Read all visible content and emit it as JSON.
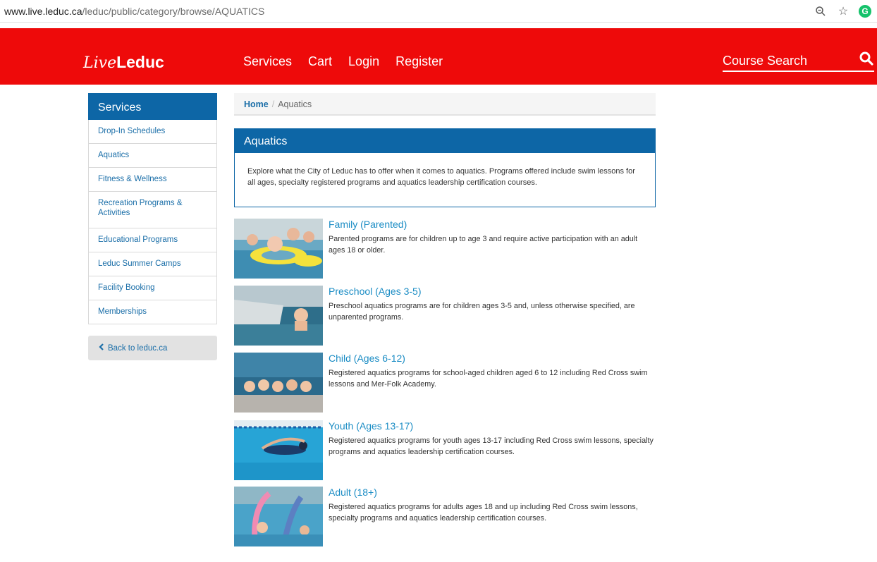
{
  "browser": {
    "url_host": "www.live.leduc.ca",
    "url_path": "/leduc/public/category/browse/AQUATICS",
    "icons": [
      "zoom-icon",
      "star-icon",
      "grammarly-icon"
    ],
    "grammarly_letter": "G"
  },
  "header": {
    "logo_script": "Live",
    "logo_bold": "Leduc",
    "nav": [
      "Services",
      "Cart",
      "Login",
      "Register"
    ],
    "search_placeholder": "Course Search",
    "colors": {
      "header_bg": "#ee0a0a",
      "accent": "#0d66a6",
      "link": "#1a6ea8"
    }
  },
  "sidebar": {
    "title": "Services",
    "items": [
      "Drop-In Schedules",
      "Aquatics",
      "Fitness & Wellness",
      "Recreation Programs & Activities",
      "Educational Programs",
      "Leduc Summer Camps",
      "Facility Booking",
      "Memberships"
    ],
    "back": "Back to leduc.ca"
  },
  "breadcrumb": {
    "home": "Home",
    "separator": "/",
    "current": "Aquatics"
  },
  "panel": {
    "title": "Aquatics",
    "description": "Explore what the City of Leduc has to offer when it comes to aquatics. Programs offered include swim lessons for all ages, specialty registered programs and aquatics leadership certification courses."
  },
  "categories": [
    {
      "title": "Family (Parented)",
      "description": "Parented programs are for children up to age 3 and require active participation with an adult ages 18 or older."
    },
    {
      "title": "Preschool (Ages 3-5)",
      "description": "Preschool aquatics programs are for children ages 3-5 and, unless otherwise specified, are unparented programs."
    },
    {
      "title": "Child (Ages 6-12)",
      "description": "Registered aquatics programs for school-aged children aged 6 to 12 including Red Cross swim lessons and Mer-Folk Academy."
    },
    {
      "title": "Youth (Ages 13-17)",
      "description": "Registered aquatics programs for youth ages 13-17 including Red Cross swim lessons, specialty programs and aquatics leadership certification courses."
    },
    {
      "title": "Adult (18+)",
      "description": "Registered aquatics programs for adults ages 18 and up including Red Cross swim lessons, specialty programs and aquatics leadership certification courses."
    }
  ]
}
